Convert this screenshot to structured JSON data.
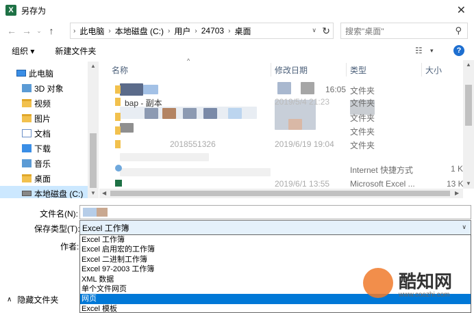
{
  "window": {
    "title": "另存为"
  },
  "address": {
    "segments": [
      "此电脑",
      "本地磁盘 (C:)",
      "用户",
      "24703",
      "桌面"
    ],
    "search_placeholder": "搜索\"桌面\""
  },
  "toolbar": {
    "organize": "组织 ▾",
    "new_folder": "新建文件夹"
  },
  "nav": {
    "items": [
      {
        "label": "此电脑",
        "icon": "pc-icon"
      },
      {
        "label": "3D 对象",
        "icon": "3d-objects-icon"
      },
      {
        "label": "视频",
        "icon": "video-icon"
      },
      {
        "label": "图片",
        "icon": "pictures-icon"
      },
      {
        "label": "文档",
        "icon": "documents-icon"
      },
      {
        "label": "下载",
        "icon": "downloads-icon"
      },
      {
        "label": "音乐",
        "icon": "music-icon"
      },
      {
        "label": "桌面",
        "icon": "desktop-icon"
      },
      {
        "label": "本地磁盘 (C:)",
        "icon": "drive-icon"
      }
    ]
  },
  "files": {
    "columns": [
      "名称",
      "修改日期",
      "类型",
      "大小"
    ],
    "rows": [
      {
        "name": "",
        "date": "16:05",
        "type": "文件夹",
        "size": ""
      },
      {
        "name": "bap - 副本",
        "date": "2019/5/4 21:23",
        "type": "文件夹",
        "size": ""
      },
      {
        "name": "",
        "date": "",
        "type": "文件夹",
        "size": ""
      },
      {
        "name": "",
        "date": "",
        "type": "文件夹",
        "size": ""
      },
      {
        "name": "2018551326",
        "date": "2019/6/19 19:04",
        "type": "文件夹",
        "size": ""
      },
      {
        "name": "",
        "date": "",
        "type": "Internet 快捷方式",
        "size": "1 K"
      },
      {
        "name": "",
        "date": "2019/6/1 13:55",
        "type": "Microsoft Excel ...",
        "size": "13 K"
      }
    ]
  },
  "form": {
    "filename_label": "文件名(N):",
    "filename_value": "",
    "filetype_label": "保存类型(T):",
    "filetype_value": "Excel 工作簿",
    "author_label": "作者:",
    "hide_folders": "隐藏文件夹",
    "type_options": [
      "Excel 工作簿",
      "Excel 启用宏的工作簿",
      "Excel 二进制工作簿",
      "Excel 97-2003 工作簿",
      "XML 数据",
      "单个文件网页",
      "网页",
      "Excel 模板"
    ],
    "selected_option": "网页"
  },
  "watermark": {
    "brand": "酷知网",
    "url": "www.coozhi.com"
  },
  "colors": {
    "selection": "#0078d7",
    "nav_selected": "#cce8ff",
    "combo_bg": "#e5f1fb"
  }
}
